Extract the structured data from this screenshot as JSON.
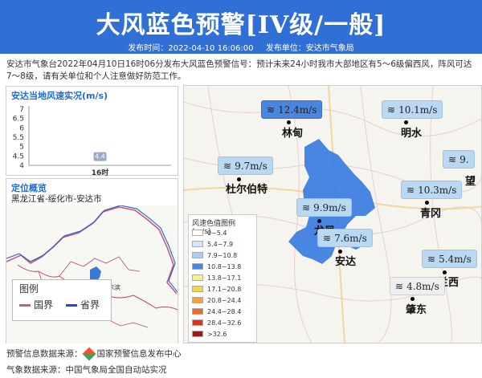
{
  "header": {
    "title": "大风蓝色预警[IV级/一般]",
    "publish_time": "发布时间：2022-04-10 16:06:00",
    "publisher": "发布单位：安达市气象局"
  },
  "description": "安达市气象台2022年04月10日16时06分发布大风蓝色预警信号：预计未来24小时我市大部地区有5～6级偏西风，阵风可达7～8级，请有关单位和个人注意做好防范工作。",
  "wind_panel": {
    "title": "安达当地风速实况(m/s)",
    "chart_data": {
      "type": "scatter",
      "title": "安达当地风速实况(m/s)",
      "categories": [
        "16时"
      ],
      "values": [
        4.4
      ],
      "yticks": [
        "7",
        "6.5",
        "6",
        "5.5",
        "5",
        "4.5",
        "4"
      ],
      "ylim": [
        4,
        7
      ]
    }
  },
  "location_panel": {
    "title": "定位概览",
    "location": "黑龙江省-绥化市-安达市",
    "city_label": "哈尔滨",
    "legend_title": "图例",
    "legend_items": [
      {
        "label": "国界",
        "color": "#c06080"
      },
      {
        "label": "省界",
        "color": "#1b4fc9"
      }
    ]
  },
  "map": {
    "stations": [
      {
        "speed": "12.4m/s",
        "color": "#4a86e0",
        "city": "林甸"
      },
      {
        "speed": "10.1m/s",
        "color": "#b8d8f4",
        "city": "明水"
      },
      {
        "speed": "9.7m/s",
        "color": "#b8d8f4",
        "city": "杜尔伯特"
      },
      {
        "speed": "9.9m/s",
        "color": "#b8d8f4",
        "city": "龙凤"
      },
      {
        "speed": "10.3m/s",
        "color": "#b8d8f4",
        "city": "青冈"
      },
      {
        "speed": "7.6m/s",
        "color": "#b8d8f4",
        "city": "安达"
      },
      {
        "speed": "5.4m/s",
        "color": "#b8d8f4",
        "city": "兰西"
      },
      {
        "speed": "4.8m/s",
        "color": "#eeeeee",
        "city": "肇东"
      },
      {
        "speed": "9.",
        "color": "#b8d8f4",
        "city": "望"
      }
    ],
    "legend_title": "风速色值图例 (m/s)",
    "legend": [
      {
        "range": "0~5.4",
        "color": "#ffffff"
      },
      {
        "range": "5.4~7.9",
        "color": "#d6e8f8"
      },
      {
        "range": "7.9~10.8",
        "color": "#a9cff3"
      },
      {
        "range": "10.8~13.8",
        "color": "#4a86e0"
      },
      {
        "range": "13.8~17.1",
        "color": "#f6f38a"
      },
      {
        "range": "17.1~20.8",
        "color": "#f6d34a"
      },
      {
        "range": "20.8~24.4",
        "color": "#f3a23a"
      },
      {
        "range": "24.4~28.4",
        "color": "#ee6a2a"
      },
      {
        "range": "28.4~32.6",
        "color": "#d8342a"
      },
      {
        "range": ">32.6",
        "color": "#9b1a1a"
      }
    ]
  },
  "sources": {
    "warning": "预警信息数据来源：",
    "warning_org": "国家预警信息发布中心",
    "weather": "气象数据来源：中国气象局全国自动站实况"
  }
}
